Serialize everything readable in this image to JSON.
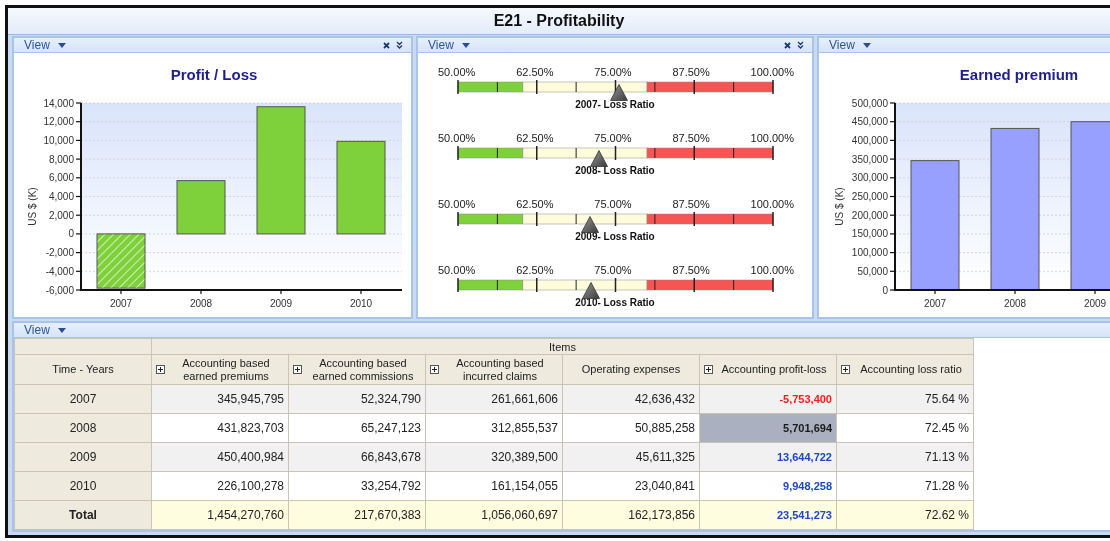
{
  "window": {
    "title": "E21 - Profitability"
  },
  "panels": [
    {
      "menu": "View",
      "closable": true,
      "chart_data": {
        "type": "bar",
        "title": "Profit / Loss",
        "ylabel": "US $ (K)",
        "grid": true,
        "categories": [
          "2007",
          "2008",
          "2009",
          "2010"
        ],
        "series": [
          {
            "color": "#7fd13b",
            "values": [
              -5800,
              5700,
              13600,
              9900
            ]
          }
        ],
        "ylim": [
          -6000,
          14000
        ],
        "yticks": [
          {
            "value": -6000,
            "label": "-6,000"
          },
          {
            "value": -4000,
            "label": "-4,000"
          },
          {
            "value": -2000,
            "label": "-2,000"
          },
          {
            "value": 0,
            "label": "0"
          },
          {
            "value": 2000,
            "label": "2,000"
          },
          {
            "value": 4000,
            "label": "4,000"
          },
          {
            "value": 6000,
            "label": "6,000"
          },
          {
            "value": 8000,
            "label": "8,000"
          },
          {
            "value": 10000,
            "label": "10,000"
          },
          {
            "value": 12000,
            "label": "12,000"
          },
          {
            "value": 14000,
            "label": "14,000"
          }
        ]
      }
    },
    {
      "menu": "View",
      "closable": true,
      "gauges": [
        {
          "caption": "2007- Loss Ratio",
          "level": 0.5128,
          "scale": [
            "50.00%",
            "62.50%",
            "75.00%",
            "87.50%",
            "100.00%"
          ]
        },
        {
          "caption": "2008- Loss Ratio",
          "level": 0.449,
          "scale": [
            "50.00%",
            "62.50%",
            "75.00%",
            "87.50%",
            "100.00%"
          ]
        },
        {
          "caption": "2009- Loss Ratio",
          "level": 0.4226,
          "scale": [
            "50.00%",
            "62.50%",
            "75.00%",
            "87.50%",
            "100.00%"
          ]
        },
        {
          "caption": "2010- Loss Ratio",
          "level": 0.4256,
          "scale": [
            "50.00%",
            "62.50%",
            "75.00%",
            "87.50%",
            "100.00%"
          ]
        }
      ]
    },
    {
      "menu": "View",
      "chart_data": {
        "type": "bar",
        "title": "Earned premium",
        "ylabel": "US $ (K)",
        "grid": true,
        "categories": [
          "2007",
          "2008",
          "2009"
        ],
        "series": [
          {
            "color": "#97a0ff",
            "values": [
              346000,
              432000,
              450000
            ]
          }
        ],
        "ylim": [
          0,
          500000
        ],
        "yticks": [
          {
            "value": 0,
            "label": "0"
          },
          {
            "value": 50000,
            "label": "50,000"
          },
          {
            "value": 100000,
            "label": "100,000"
          },
          {
            "value": 150000,
            "label": "150,000"
          },
          {
            "value": 200000,
            "label": "200,000"
          },
          {
            "value": 250000,
            "label": "250,000"
          },
          {
            "value": 300000,
            "label": "300,000"
          },
          {
            "value": 350000,
            "label": "350,000"
          },
          {
            "value": 400000,
            "label": "400,000"
          },
          {
            "value": 450000,
            "label": "450,000"
          },
          {
            "value": 500000,
            "label": "500,000"
          }
        ]
      }
    }
  ],
  "table": {
    "menu": "View",
    "group_header": "Items",
    "columns": [
      {
        "label": "Time - Years",
        "expandable": false
      },
      {
        "label": "Accounting based earned premiums",
        "expandable": true
      },
      {
        "label": "Accounting based earned commissions",
        "expandable": true
      },
      {
        "label": "Accounting based incurred claims",
        "expandable": true
      },
      {
        "label": "Operating expenses",
        "expandable": false
      },
      {
        "label": "Accounting profit-loss",
        "expandable": true
      },
      {
        "label": "Accounting loss ratio",
        "expandable": true
      }
    ],
    "rows": [
      {
        "kind": "data",
        "cells": [
          {
            "text": "2007",
            "selected": false
          },
          {
            "text": "345,945,795",
            "selected": false
          },
          {
            "text": "52,324,790",
            "selected": false
          },
          {
            "text": "261,661,606",
            "selected": false
          },
          {
            "text": "42,636,432",
            "selected": false
          },
          {
            "text": "-5,753,400",
            "selected": false,
            "color": "#ff1a1a"
          },
          {
            "text": "75.64 %",
            "selected": false
          }
        ]
      },
      {
        "kind": "data",
        "cells": [
          {
            "text": "2008",
            "selected": false
          },
          {
            "text": "431,823,703",
            "selected": false
          },
          {
            "text": "65,247,123",
            "selected": false
          },
          {
            "text": "312,855,537",
            "selected": false
          },
          {
            "text": "50,885,258",
            "selected": false
          },
          {
            "text": "5,701,694",
            "selected": true,
            "color": "#1a1a1a"
          },
          {
            "text": "72.45 %",
            "selected": false
          }
        ]
      },
      {
        "kind": "data",
        "cells": [
          {
            "text": "2009",
            "selected": false
          },
          {
            "text": "450,400,984",
            "selected": false
          },
          {
            "text": "66,843,678",
            "selected": false
          },
          {
            "text": "320,389,500",
            "selected": false
          },
          {
            "text": "45,611,325",
            "selected": false
          },
          {
            "text": "13,644,722",
            "selected": false,
            "color": "#1f45c8"
          },
          {
            "text": "71.13 %",
            "selected": false
          }
        ]
      },
      {
        "kind": "data",
        "cells": [
          {
            "text": "2010",
            "selected": false
          },
          {
            "text": "226,100,278",
            "selected": false
          },
          {
            "text": "33,254,792",
            "selected": false
          },
          {
            "text": "161,154,055",
            "selected": false
          },
          {
            "text": "23,040,841",
            "selected": false
          },
          {
            "text": "9,948,258",
            "selected": false,
            "color": "#1f45c8"
          },
          {
            "text": "71.28 %",
            "selected": false
          }
        ]
      },
      {
        "kind": "total",
        "cells": [
          {
            "text": "Total",
            "selected": false
          },
          {
            "text": "1,454,270,760",
            "selected": false
          },
          {
            "text": "217,670,383",
            "selected": false
          },
          {
            "text": "1,056,060,697",
            "selected": false
          },
          {
            "text": "162,173,856",
            "selected": false
          },
          {
            "text": "23,541,273",
            "selected": false,
            "color": "#1f45c8"
          },
          {
            "text": "72.62 %",
            "selected": false
          }
        ]
      }
    ]
  }
}
